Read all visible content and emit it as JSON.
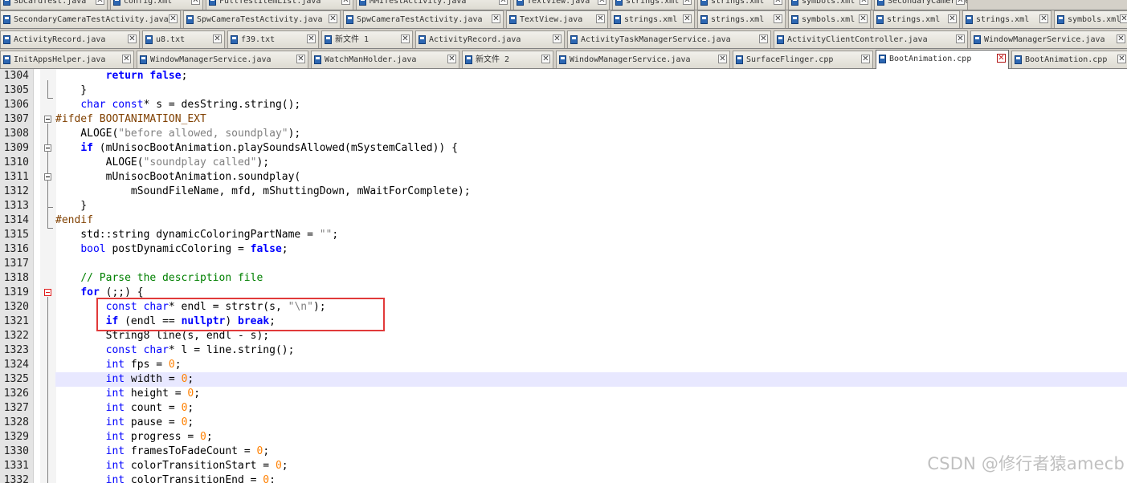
{
  "tab_rows": [
    {
      "tabs": [
        {
          "label": "SbCardTest.java"
        },
        {
          "label": "config.xml"
        },
        {
          "label": "FullTestItemList.java"
        },
        {
          "label": "MMITestActivity.java"
        },
        {
          "label": "TextView.java"
        },
        {
          "label": "strings.xml"
        },
        {
          "label": "strings.xml"
        },
        {
          "label": "symbols.xml"
        },
        {
          "label": "SecondaryCameraTestActivity.java"
        }
      ]
    },
    {
      "tabs": [
        {
          "label": "SecondaryCameraTestActivity.java"
        },
        {
          "label": "SpwCameraTestActivity.java"
        },
        {
          "label": "SpwCameraTestActivity.java"
        },
        {
          "label": "TextView.java"
        },
        {
          "label": "strings.xml"
        },
        {
          "label": "strings.xml"
        },
        {
          "label": "symbols.xml"
        },
        {
          "label": "strings.xml"
        },
        {
          "label": "strings.xml"
        },
        {
          "label": "symbols.xml"
        }
      ]
    },
    {
      "tabs": [
        {
          "label": "ActivityRecord.java"
        },
        {
          "label": "u8.txt"
        },
        {
          "label": "f39.txt"
        },
        {
          "label": "新文件 1"
        },
        {
          "label": "ActivityRecord.java"
        },
        {
          "label": "ActivityTaskManagerService.java"
        },
        {
          "label": "ActivityClientController.java"
        },
        {
          "label": "WindowManagerService.java"
        }
      ]
    },
    {
      "tabs": [
        {
          "label": "InitAppsHelper.java"
        },
        {
          "label": "WindowManagerService.java"
        },
        {
          "label": "WatchManHolder.java"
        },
        {
          "label": "新文件 2"
        },
        {
          "label": "WindowManagerService.java"
        },
        {
          "label": "SurfaceFlinger.cpp"
        },
        {
          "label": "BootAnimation.cpp",
          "active": true
        },
        {
          "label": "BootAnimation.cpp"
        }
      ]
    }
  ],
  "tab_icon": "save-disk-icon",
  "close_glyph": "✕",
  "current_line": 1325,
  "lines": [
    {
      "n": 1304,
      "segs": [
        [
          "",
          "        "
        ],
        [
          "kb",
          "return"
        ],
        [
          "",
          " "
        ],
        [
          "kb",
          "false"
        ],
        [
          "",
          ";"
        ]
      ]
    },
    {
      "n": 1305,
      "segs": [
        [
          "",
          "    }"
        ]
      ]
    },
    {
      "n": 1306,
      "segs": [
        [
          "",
          "    "
        ],
        [
          "kw",
          "char"
        ],
        [
          "",
          " "
        ],
        [
          "kw",
          "const"
        ],
        [
          "",
          "* s = desString.string();"
        ]
      ]
    },
    {
      "n": 1307,
      "segs": [
        [
          "pp",
          "#ifdef BOOTANIMATION_EXT"
        ]
      ]
    },
    {
      "n": 1308,
      "segs": [
        [
          "",
          "    ALOGE("
        ],
        [
          "str",
          "\"before allowed, soundplay\""
        ],
        [
          "",
          ");"
        ]
      ]
    },
    {
      "n": 1309,
      "segs": [
        [
          "",
          "    "
        ],
        [
          "kb",
          "if"
        ],
        [
          "",
          " (mUnisocBootAnimation.playSoundsAllowed(mSystemCalled)) {"
        ]
      ]
    },
    {
      "n": 1310,
      "segs": [
        [
          "",
          "        ALOGE("
        ],
        [
          "str",
          "\"soundplay called\""
        ],
        [
          "",
          ");"
        ]
      ]
    },
    {
      "n": 1311,
      "segs": [
        [
          "",
          "        mUnisocBootAnimation.soundplay("
        ]
      ]
    },
    {
      "n": 1312,
      "segs": [
        [
          "",
          "            mSoundFileName, mfd, mShuttingDown, mWaitForComplete);"
        ]
      ]
    },
    {
      "n": 1313,
      "segs": [
        [
          "",
          "    }"
        ]
      ]
    },
    {
      "n": 1314,
      "segs": [
        [
          "pp",
          "#endif"
        ]
      ]
    },
    {
      "n": 1315,
      "segs": [
        [
          "",
          "    std::string dynamicColoringPartName = "
        ],
        [
          "str",
          "\"\""
        ],
        [
          "",
          ";"
        ]
      ]
    },
    {
      "n": 1316,
      "segs": [
        [
          "",
          "    "
        ],
        [
          "kw",
          "bool"
        ],
        [
          "",
          " postDynamicColoring = "
        ],
        [
          "kb",
          "false"
        ],
        [
          "",
          ";"
        ]
      ]
    },
    {
      "n": 1317,
      "segs": [
        [
          "",
          ""
        ]
      ]
    },
    {
      "n": 1318,
      "segs": [
        [
          "",
          "    "
        ],
        [
          "cm",
          "// Parse the description file"
        ]
      ]
    },
    {
      "n": 1319,
      "segs": [
        [
          "",
          "    "
        ],
        [
          "kb",
          "for"
        ],
        [
          "",
          " (;;) {"
        ]
      ]
    },
    {
      "n": 1320,
      "segs": [
        [
          "",
          "        "
        ],
        [
          "kw",
          "const"
        ],
        [
          "",
          " "
        ],
        [
          "kw",
          "char"
        ],
        [
          "",
          "* endl = strstr(s, "
        ],
        [
          "str",
          "\"\\n\""
        ],
        [
          "",
          ");"
        ]
      ]
    },
    {
      "n": 1321,
      "segs": [
        [
          "",
          "        "
        ],
        [
          "kb",
          "if"
        ],
        [
          "",
          " (endl == "
        ],
        [
          "kb",
          "nullptr"
        ],
        [
          "",
          ") "
        ],
        [
          "kb",
          "break"
        ],
        [
          "",
          ";"
        ]
      ]
    },
    {
      "n": 1322,
      "segs": [
        [
          "",
          "        String8 line(s, endl - s);"
        ]
      ]
    },
    {
      "n": 1323,
      "segs": [
        [
          "",
          "        "
        ],
        [
          "kw",
          "const"
        ],
        [
          "",
          " "
        ],
        [
          "kw",
          "char"
        ],
        [
          "",
          "* l = line.string();"
        ]
      ]
    },
    {
      "n": 1324,
      "segs": [
        [
          "",
          "        "
        ],
        [
          "kw",
          "int"
        ],
        [
          "",
          " fps = "
        ],
        [
          "num",
          "0"
        ],
        [
          "",
          ";"
        ]
      ]
    },
    {
      "n": 1325,
      "segs": [
        [
          "",
          "        "
        ],
        [
          "kw",
          "int"
        ],
        [
          "",
          " width = "
        ],
        [
          "num",
          "0"
        ],
        [
          "",
          ";"
        ]
      ]
    },
    {
      "n": 1326,
      "segs": [
        [
          "",
          "        "
        ],
        [
          "kw",
          "int"
        ],
        [
          "",
          " height = "
        ],
        [
          "num",
          "0"
        ],
        [
          "",
          ";"
        ]
      ]
    },
    {
      "n": 1327,
      "segs": [
        [
          "",
          "        "
        ],
        [
          "kw",
          "int"
        ],
        [
          "",
          " count = "
        ],
        [
          "num",
          "0"
        ],
        [
          "",
          ";"
        ]
      ]
    },
    {
      "n": 1328,
      "segs": [
        [
          "",
          "        "
        ],
        [
          "kw",
          "int"
        ],
        [
          "",
          " pause = "
        ],
        [
          "num",
          "0"
        ],
        [
          "",
          ";"
        ]
      ]
    },
    {
      "n": 1329,
      "segs": [
        [
          "",
          "        "
        ],
        [
          "kw",
          "int"
        ],
        [
          "",
          " progress = "
        ],
        [
          "num",
          "0"
        ],
        [
          "",
          ";"
        ]
      ]
    },
    {
      "n": 1330,
      "segs": [
        [
          "",
          "        "
        ],
        [
          "kw",
          "int"
        ],
        [
          "",
          " framesToFadeCount = "
        ],
        [
          "num",
          "0"
        ],
        [
          "",
          ";"
        ]
      ]
    },
    {
      "n": 1331,
      "segs": [
        [
          "",
          "        "
        ],
        [
          "kw",
          "int"
        ],
        [
          "",
          " colorTransitionStart = "
        ],
        [
          "num",
          "0"
        ],
        [
          "",
          ";"
        ]
      ]
    },
    {
      "n": 1332,
      "segs": [
        [
          "",
          "        "
        ],
        [
          "kw",
          "int"
        ],
        [
          "",
          " colorTransitionEnd = "
        ],
        [
          "num",
          "0"
        ],
        [
          "",
          ";"
        ]
      ]
    }
  ],
  "watermark": "CSDN @修行者猿amecb"
}
